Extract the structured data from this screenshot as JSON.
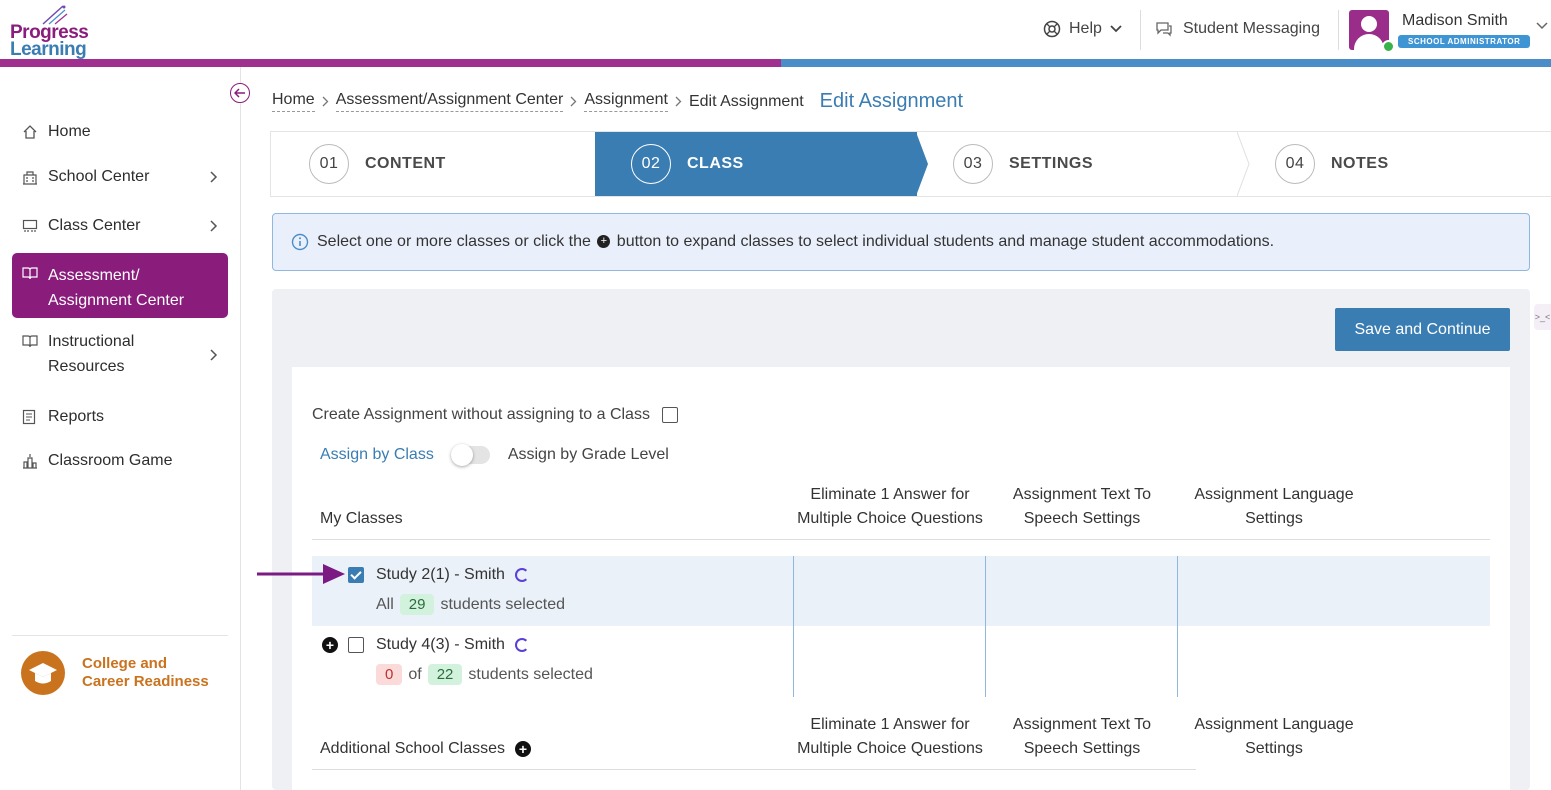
{
  "brand": {
    "line1": "Progress",
    "line2": "Learning"
  },
  "header": {
    "help_label": "Help",
    "messaging_label": "Student Messaging",
    "user_name": "Madison Smith",
    "user_role": "SCHOOL ADMINISTRATOR"
  },
  "sidebar": {
    "items": [
      {
        "label": "Home",
        "icon": "home-icon",
        "has_chevron": false
      },
      {
        "label": "School Center",
        "icon": "school-icon",
        "has_chevron": true
      },
      {
        "label": "Class Center",
        "icon": "classroom-icon",
        "has_chevron": true
      },
      {
        "label_line1": "Assessment/",
        "label_line2": "Assignment Center",
        "icon": "book-icon",
        "active": true
      },
      {
        "label_line1": "Instructional",
        "label_line2": "Resources",
        "icon": "open-book-icon",
        "has_chevron": true
      },
      {
        "label": "Reports",
        "icon": "report-icon"
      },
      {
        "label": "Classroom Game",
        "icon": "game-icon"
      }
    ],
    "ccr_line1": "College and",
    "ccr_line2": "Career Readiness"
  },
  "breadcrumb": {
    "items": [
      "Home",
      "Assessment/Assignment Center",
      "Assignment"
    ],
    "current": "Edit Assignment",
    "page_title": "Edit Assignment"
  },
  "steps": [
    {
      "num": "01",
      "label": "CONTENT"
    },
    {
      "num": "02",
      "label": "CLASS",
      "active": true
    },
    {
      "num": "03",
      "label": "SETTINGS"
    },
    {
      "num": "04",
      "label": "NOTES"
    }
  ],
  "info": {
    "text_before": "Select one or more classes or click the",
    "text_after": "button to expand classes to select individual students and manage student accommodations."
  },
  "actions": {
    "save_label": "Save and Continue"
  },
  "form": {
    "create_without_class": "Create Assignment without assigning to a Class",
    "assign_by_class": "Assign by Class",
    "assign_by_grade": "Assign by Grade Level"
  },
  "table": {
    "my_classes_label": "My Classes",
    "additional_label": "Additional School Classes",
    "col_eliminate_1": "Eliminate 1 Answer for",
    "col_eliminate_2": "Multiple Choice Questions",
    "col_tts_1": "Assignment Text To",
    "col_tts_2": "Speech Settings",
    "col_lang_1": "Assignment Language",
    "col_lang_2": "Settings",
    "classes": [
      {
        "name": "Study 2(1) - Smith",
        "checked": true,
        "all_label": "All",
        "total": "29",
        "suffix": "students selected"
      },
      {
        "name": "Study 4(3) - Smith",
        "checked": false,
        "selected": "0",
        "of_label": "of",
        "total": "22",
        "suffix": "students selected"
      }
    ]
  },
  "colors": {
    "brand_purple": "#8a1c7c",
    "brand_blue": "#3a7db3",
    "accent_orange": "#c9731f"
  }
}
